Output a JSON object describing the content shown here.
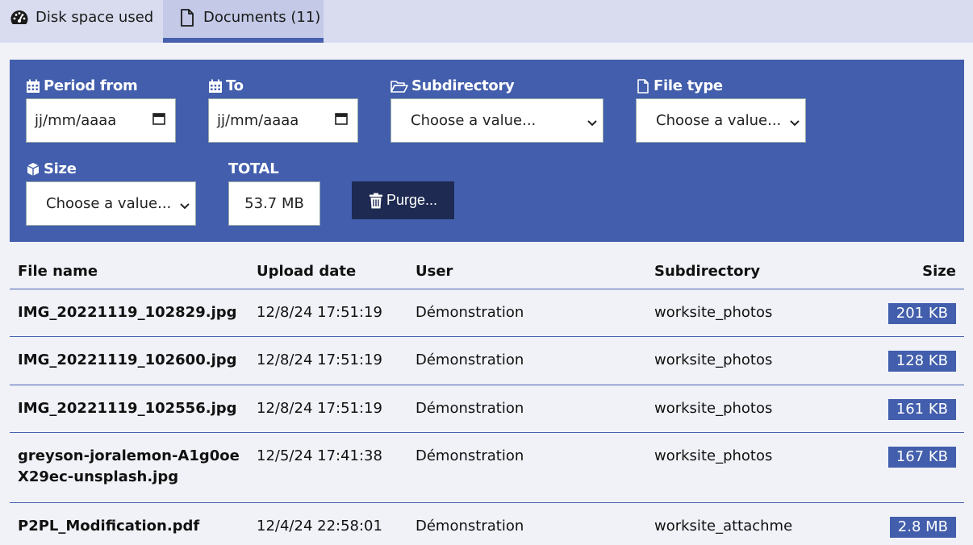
{
  "tabs": [
    {
      "label": "Disk space used",
      "icon": "gauge-icon"
    },
    {
      "label": "Documents (11)",
      "icon": "document-icon"
    }
  ],
  "filters": {
    "period_from_label": "Period from",
    "period_from_value": "jj/mm/aaaa",
    "to_label": "To",
    "to_value": "jj/mm/aaaa",
    "subdirectory_label": "Subdirectory",
    "subdirectory_value": "Choose a value...",
    "file_type_label": "File type",
    "file_type_value": "Choose a value...",
    "size_label": "Size",
    "size_value": "Choose a value...",
    "total_label": "TOTAL",
    "total_value": "53.7 MB",
    "purge_label": "Purge..."
  },
  "table": {
    "headers": {
      "name": "File name",
      "date": "Upload date",
      "user": "User",
      "subdirectory": "Subdirectory",
      "size": "Size"
    },
    "rows": [
      {
        "name": "IMG_20221119_102829.jpg",
        "date": "12/8/24 17:51:19",
        "user": "Démonstration",
        "subdirectory": "worksite_photos",
        "size": "201 KB"
      },
      {
        "name": "IMG_20221119_102600.jpg",
        "date": "12/8/24 17:51:19",
        "user": "Démonstration",
        "subdirectory": "worksite_photos",
        "size": "128 KB"
      },
      {
        "name": "IMG_20221119_102556.jpg",
        "date": "12/8/24 17:51:19",
        "user": "Démonstration",
        "subdirectory": "worksite_photos",
        "size": "161 KB"
      },
      {
        "name": "greyson-joralemon-A1g0oeX29ec-unsplash.jpg",
        "date": "12/5/24 17:41:38",
        "user": "Démonstration",
        "subdirectory": "worksite_photos",
        "size": "167 KB"
      },
      {
        "name": "P2PL_Modification.pdf",
        "date": "12/4/24 22:58:01",
        "user": "Démonstration",
        "subdirectory": "worksite_attachme",
        "size": "2.8 MB"
      }
    ]
  },
  "colors": {
    "accent": "#425eac",
    "dark_button": "#1e2a52",
    "tabbar": "#d8dcee"
  }
}
